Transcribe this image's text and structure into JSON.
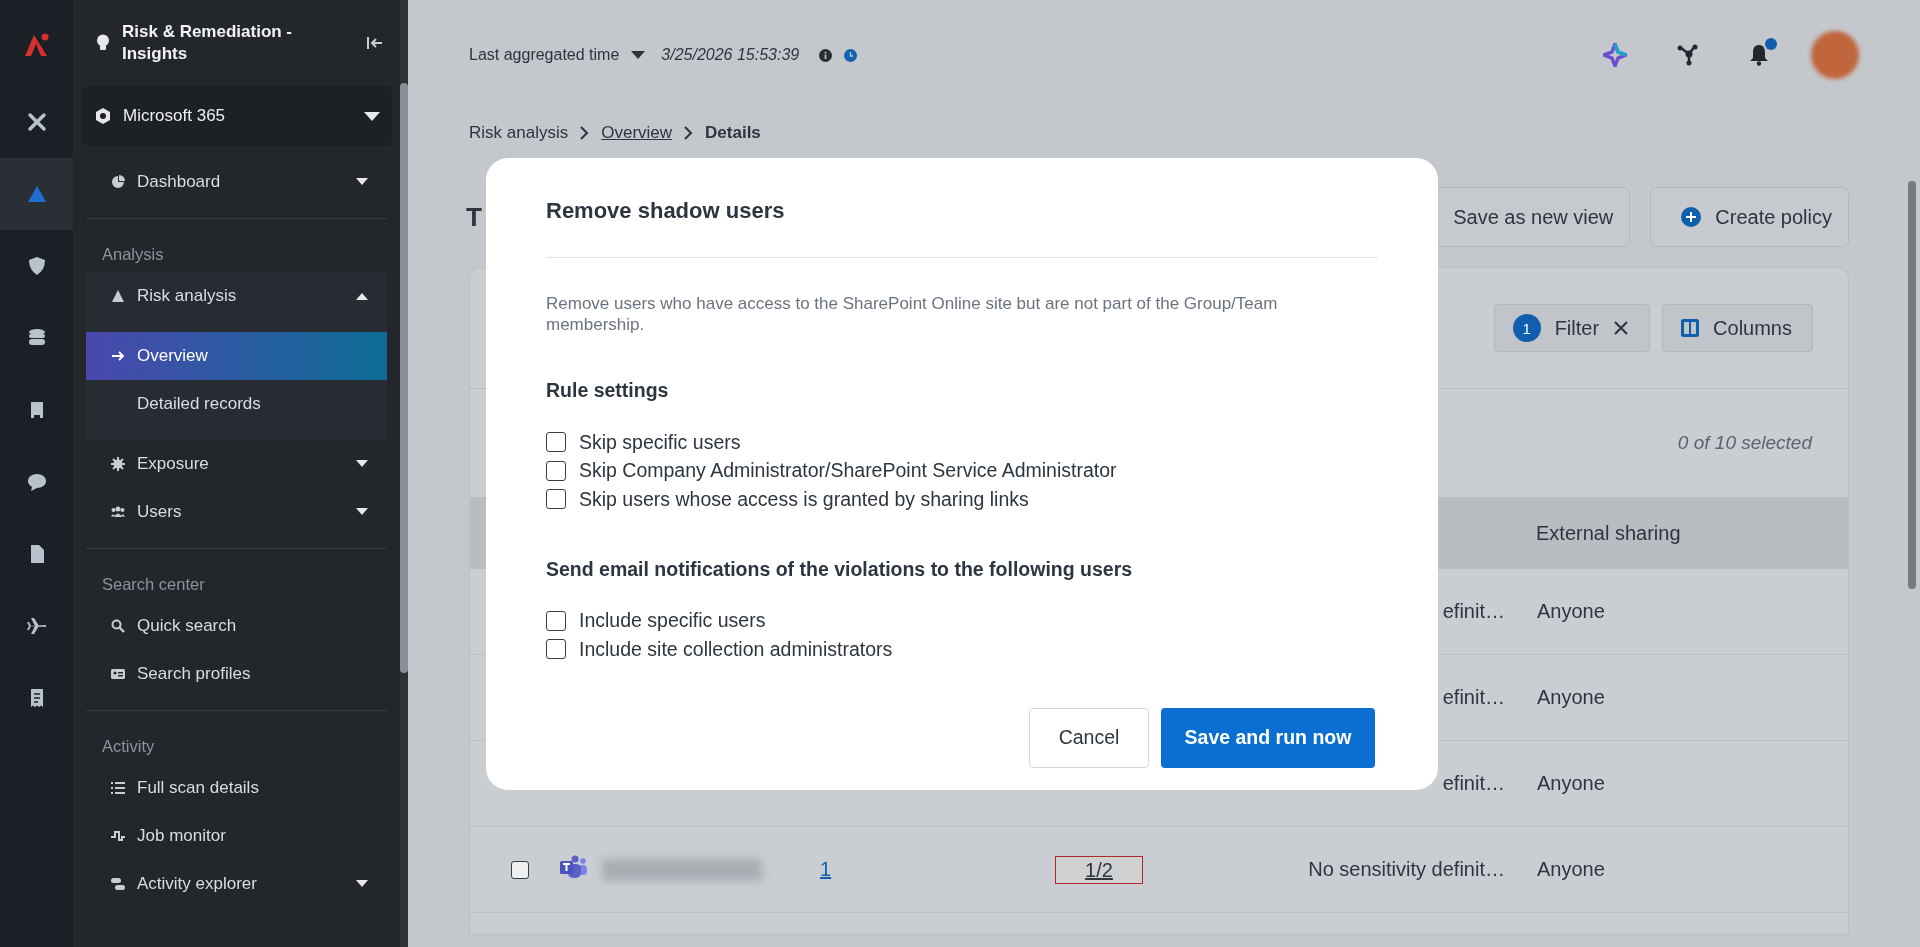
{
  "icon_rail": [
    {
      "selected": false
    },
    {
      "selected": true
    },
    {
      "selected": false
    },
    {
      "selected": false
    },
    {
      "selected": false
    },
    {
      "selected": false
    },
    {
      "selected": false
    },
    {
      "selected": false
    },
    {
      "selected": false
    }
  ],
  "sidebar": {
    "title": "Risk & Remediation - Insights",
    "product": "Microsoft 365",
    "sections": [
      {
        "items": [
          {
            "label": "Dashboard",
            "kind": "group",
            "expanded": false,
            "selected": false
          }
        ]
      },
      {
        "heading": "Analysis",
        "items": [
          {
            "label": "Risk analysis",
            "kind": "group",
            "expanded": true,
            "selected": false,
            "children": [
              {
                "label": "Overview",
                "selected": true
              },
              {
                "label": "Detailed records",
                "selected": false
              }
            ]
          },
          {
            "label": "Exposure",
            "kind": "group",
            "expanded": false,
            "selected": false
          },
          {
            "label": "Users",
            "kind": "group",
            "expanded": false,
            "selected": false
          }
        ]
      },
      {
        "heading": "Search center",
        "items": [
          {
            "label": "Quick search",
            "kind": "link",
            "selected": false
          },
          {
            "label": "Search profiles",
            "kind": "link",
            "selected": false
          }
        ]
      },
      {
        "heading": "Activity",
        "items": [
          {
            "label": "Full scan details",
            "kind": "link",
            "selected": false
          },
          {
            "label": "Job monitor",
            "kind": "link",
            "selected": false
          },
          {
            "label": "Activity explorer",
            "kind": "group",
            "expanded": false,
            "selected": false
          }
        ]
      }
    ]
  },
  "topbar": {
    "label": "Last aggregated time",
    "time": "3/25/2026 15:53:39",
    "unread": true
  },
  "breadcrumb": [
    {
      "label": "Risk analysis",
      "kind": "text"
    },
    {
      "label": "Overview",
      "kind": "link"
    },
    {
      "label": "Details",
      "kind": "current"
    }
  ],
  "page": {
    "title": "T",
    "actions": [
      {
        "label": "Save as new view",
        "kind": "plain"
      },
      {
        "label": "Create policy",
        "kind": "add"
      }
    ]
  },
  "table": {
    "filter": {
      "count": "1",
      "label": "Filter"
    },
    "columns_button": "Columns",
    "selection": "0 of 10 selected",
    "columns": [
      {
        "label": "External sharing"
      }
    ],
    "rows": [
      {
        "kind": "partial",
        "sensitivity": "efinit…",
        "sharing": "Anyone"
      },
      {
        "kind": "partial",
        "sensitivity": "efinit…",
        "sharing": "Anyone"
      },
      {
        "kind": "partial",
        "sensitivity": "efinit…",
        "sharing": "Anyone"
      },
      {
        "kind": "full",
        "checked": false,
        "count": "1",
        "ratio": "1/2",
        "sensitivity": "No sensitivity definit…",
        "sharing": "Anyone"
      }
    ]
  },
  "modal": {
    "title": "Remove shadow users",
    "description": "Remove users who have access to the SharePoint Online site but are not part of the Group/Team membership.",
    "sections": [
      {
        "heading": "Rule settings",
        "options": [
          {
            "label": "Skip specific users",
            "checked": false
          },
          {
            "label": "Skip Company Administrator/SharePoint Service Administrator",
            "checked": false
          },
          {
            "label": "Skip users whose access is granted by sharing links",
            "checked": false
          }
        ]
      },
      {
        "heading": "Send email notifications of the violations to the following users",
        "options": [
          {
            "label": "Include specific users",
            "checked": false
          },
          {
            "label": "Include site collection administrators",
            "checked": false
          }
        ]
      }
    ],
    "buttons": [
      {
        "label": "Cancel",
        "kind": "secondary"
      },
      {
        "label": "Save and run now",
        "kind": "primary"
      }
    ]
  }
}
